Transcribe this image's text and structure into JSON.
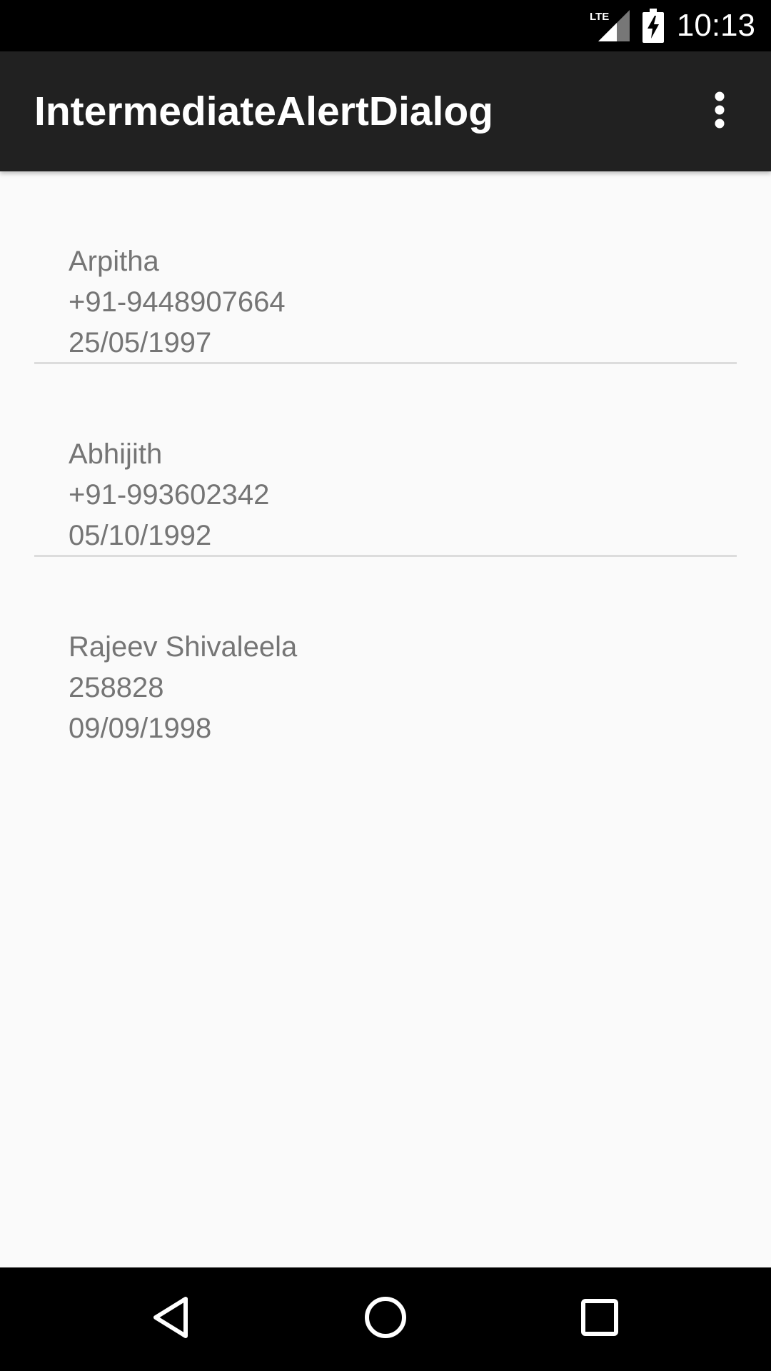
{
  "status_bar": {
    "network_label": "LTE",
    "time": "10:13",
    "icons": [
      "lte-signal-icon",
      "battery-charging-icon"
    ]
  },
  "app_bar": {
    "title": "IntermediateAlertDialog",
    "overflow_icon": "more-vert-icon",
    "background": "#212121"
  },
  "contacts": [
    {
      "name": "Arpitha",
      "phone": "+91-9448907664",
      "dob": "25/05/1997"
    },
    {
      "name": "Abhijith",
      "phone": "+91-993602342",
      "dob": "05/10/1992"
    },
    {
      "name": "Rajeev Shivaleela",
      "phone": "258828",
      "dob": "09/09/1998"
    }
  ],
  "nav_bar": {
    "back_icon": "back-triangle-icon",
    "home_icon": "home-circle-icon",
    "recents_icon": "recents-square-icon"
  },
  "colors": {
    "text_secondary": "#757575",
    "divider": "#dcdcdc",
    "background": "#fafafa"
  }
}
